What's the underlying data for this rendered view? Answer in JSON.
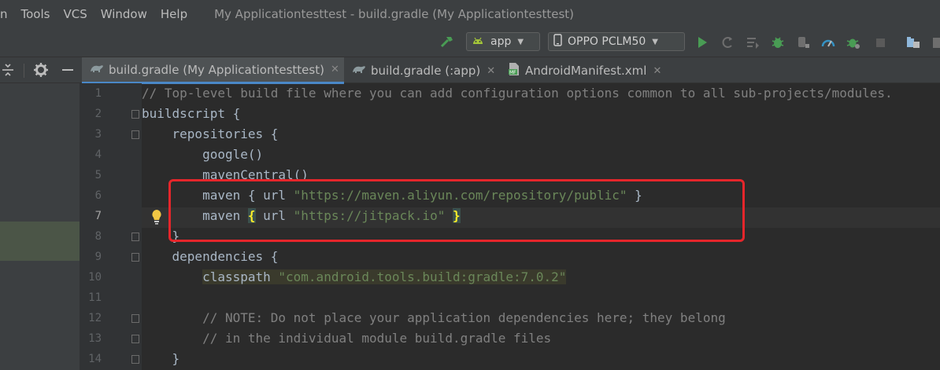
{
  "menubar": {
    "items": [
      "n",
      "Tools",
      "VCS",
      "Window",
      "Help"
    ],
    "title": "My Applicationtesttest - build.gradle (My Applicationtesttest)"
  },
  "toolbar": {
    "run_config": "app",
    "device": "OPPO PCLM50"
  },
  "tabs": [
    {
      "label": "build.gradle (My Applicationtesttest)",
      "icon": "gradle-icon",
      "active": true
    },
    {
      "label": "build.gradle (:app)",
      "icon": "gradle-icon",
      "active": false
    },
    {
      "label": "AndroidManifest.xml",
      "icon": "manifest-icon",
      "active": false
    }
  ],
  "editor": {
    "current_line": 7,
    "line_numbers": [
      "1",
      "2",
      "3",
      "4",
      "5",
      "6",
      "7",
      "8",
      "9",
      "10",
      "11",
      "12",
      "13",
      "14"
    ],
    "lines": {
      "l1": "// Top-level build file where you can add configuration options common to all sub-projects/modules.",
      "l2": "buildscript {",
      "l3": "    repositories {",
      "l4": "        google()",
      "l5": "        mavenCentral()",
      "l6_a": "        maven { url ",
      "l6_s": "\"https://maven.aliyun.com/repository/public\"",
      "l6_b": " }",
      "l7_a": "        maven ",
      "l7_brace1": "{",
      "l7_b": " url ",
      "l7_s": "\"https://jitpack.io\"",
      "l7_c": " ",
      "l7_brace2": "}",
      "l8": "    }",
      "l9": "    dependencies {",
      "l10_a": "        ",
      "l10_b": "classpath ",
      "l10_s": "\"com.android.tools.build:gradle:7.0.2\"",
      "l11": "",
      "l12": "        // NOTE: Do not place your application dependencies here; they belong",
      "l13": "        // in the individual module build.gradle files",
      "l14": "    }"
    }
  },
  "colors": {
    "accent_tab_underline": "#4a88c7",
    "annotation_box": "#e5262b",
    "run_green": "#499c54",
    "string": "#6a8759",
    "comment": "#808080"
  }
}
